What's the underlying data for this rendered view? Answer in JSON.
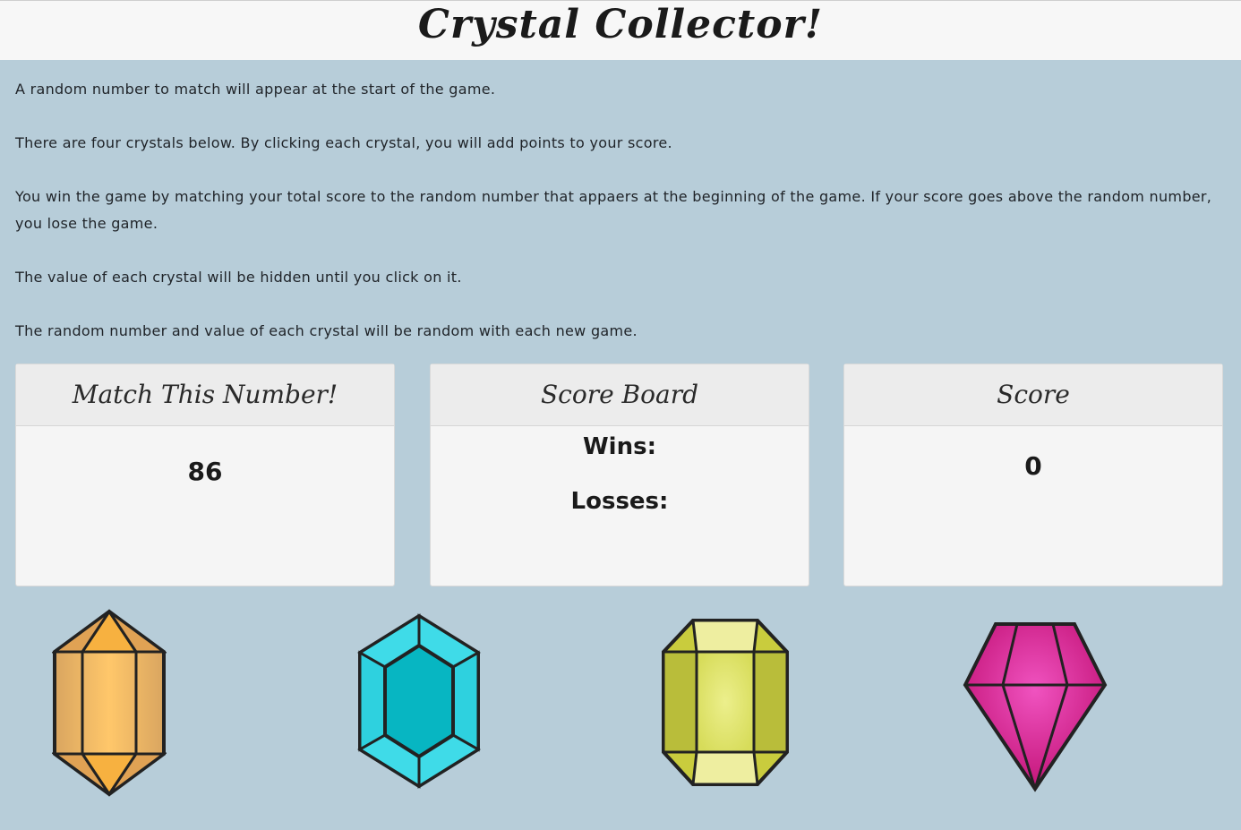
{
  "header": {
    "title": "Crystal Collector!"
  },
  "instructions": [
    "A random number to match will appear at the start of the game.",
    "There are four crystals below. By clicking each crystal, you will add points to your score.",
    "You win the game by matching your total score to the random number that appaers at the beginning of the game. If your score goes above the random number, you lose the game.",
    "The value of each crystal will be hidden until you click on it.",
    "The random number and value of each crystal will be random with each new game."
  ],
  "panels": {
    "target": {
      "title": "Match This Number!",
      "value": "86"
    },
    "scoreboard": {
      "title": "Score Board",
      "wins_label": "Wins:",
      "losses_label": "Losses:"
    },
    "score": {
      "title": "Score",
      "value": "0"
    }
  },
  "crystals": [
    {
      "name": "orange-crystal",
      "color": "#f5b342"
    },
    {
      "name": "teal-crystal",
      "color": "#14b8c4"
    },
    {
      "name": "yellow-crystal",
      "color": "#e1e36e"
    },
    {
      "name": "pink-crystal",
      "color": "#e0208f"
    }
  ]
}
